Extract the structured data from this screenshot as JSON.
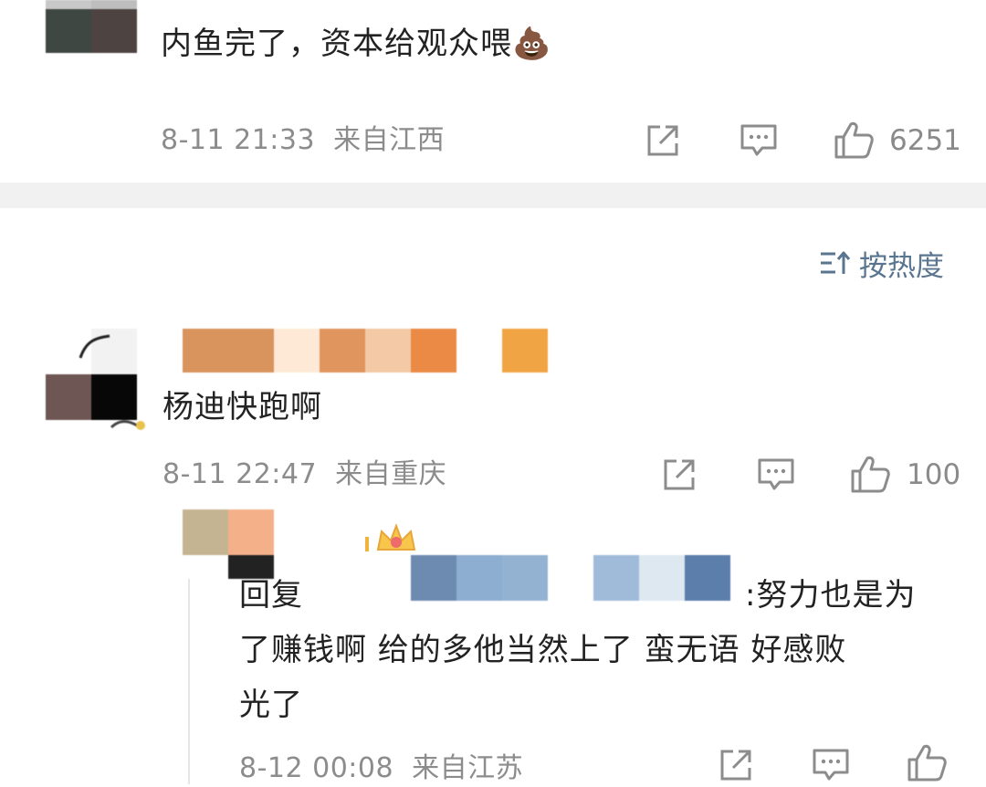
{
  "comment1": {
    "text": "内鱼完了，资本给观众喂",
    "emoji": "💩",
    "time": "8-11 21:33",
    "location": "来自江西",
    "likes": "6251"
  },
  "sort": {
    "label": "按热度"
  },
  "comment2": {
    "text": "杨迪快跑啊",
    "time": "8-11 22:47",
    "location": "来自重庆",
    "likes": "100"
  },
  "reply1": {
    "prefix": "回复",
    "line1_tail": ":努力也是为",
    "line2": "了赚钱啊 给的多他当然上了 蛮无语 好感败",
    "line3": "光了",
    "time": "8-12 00:08",
    "location": "来自江苏"
  },
  "colors": {
    "meta_gray": "#8c8c8c",
    "sort_blue": "#5a7590",
    "divider": "#f1f1f1"
  },
  "icons": [
    "share-icon",
    "comment-icon",
    "like-icon",
    "sort-icon",
    "crown-icon"
  ]
}
